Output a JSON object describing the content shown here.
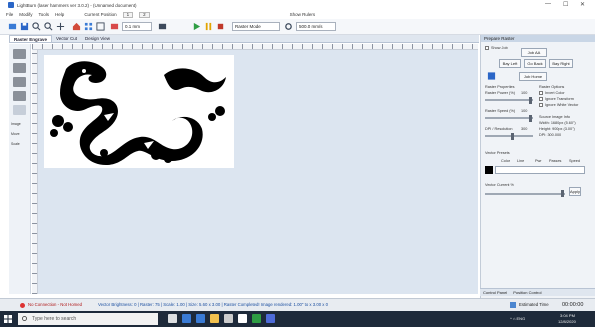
{
  "window": {
    "title": "LightBurn (laser hammers ver 3.0.2) - (Unnamed document)",
    "controls": [
      "—",
      "☐",
      "✕"
    ]
  },
  "menu": {
    "items": [
      "File",
      "Modify",
      "Tools",
      "Help"
    ],
    "extra_buttons": [
      "Current Position",
      "1",
      "2"
    ],
    "right_label": "Show Rulers"
  },
  "toolbar": {
    "mode_select": "Raster Mode",
    "speed_select": "500.0 mm/s",
    "step_label": "0.1 mm"
  },
  "tabs": [
    "Raster Engrave",
    "Vector Cut",
    "Design View"
  ],
  "left_tools": [
    "Select",
    "Line",
    "Rect",
    "Ellipse",
    "Text",
    "Image",
    "Move",
    "Scale"
  ],
  "right_panel": {
    "header": "Prepare Raster",
    "show_job_checkbox": "Show Job",
    "buttons": {
      "job_aa": "Job AA",
      "bay_left": "Bay Left",
      "go_back": "Go Back",
      "bay_right": "Bay Right",
      "job_home": "Job Home",
      "apply": "Apply"
    },
    "raster_properties": "Raster Properties",
    "raster_options": "Raster Options",
    "option_labels": [
      "Invert Color",
      "Ignore Transform",
      "Ignore White Vector"
    ],
    "power_label": "Raster Power (%)",
    "power_value": "100",
    "speed_label": "Raster Speed (%)",
    "speed_value": "100",
    "dpi_label": "DPI / Resolution",
    "dpi_value": "300",
    "info_lines": [
      "Source Image Info",
      "Width: 1680px (5.60\")",
      "Height: 900px (3.00\")",
      "DPI: 300.000"
    ],
    "vector_header": "Vector Presets",
    "vector_cols": [
      "Color",
      "Line",
      "Pwr",
      "Passes",
      "Speed"
    ],
    "vector_current": "Vector Current %",
    "bottom_tabs": [
      "Control Panel",
      "Position Control"
    ]
  },
  "status": {
    "connection": "No Connection - Not Homed",
    "message": "Vector Brightness: 0 | Raster: 75 | Scale: 1.00 | Size: 5.60 x 3.00 | Raster Completed! Image rendered: 1.00\" to x 3.00 x 0",
    "estimated_label": "Estimated Time",
    "time": "00:00:00"
  },
  "taskbar": {
    "search_placeholder": "Type here to search",
    "time": "3:04 PM",
    "date": "12/8/2020",
    "tray": "^ ⌂ ENG"
  },
  "colors": {
    "accent": "#2b66c7",
    "canvas": "#dce5f0",
    "taskbar": "#1e2a3a"
  }
}
